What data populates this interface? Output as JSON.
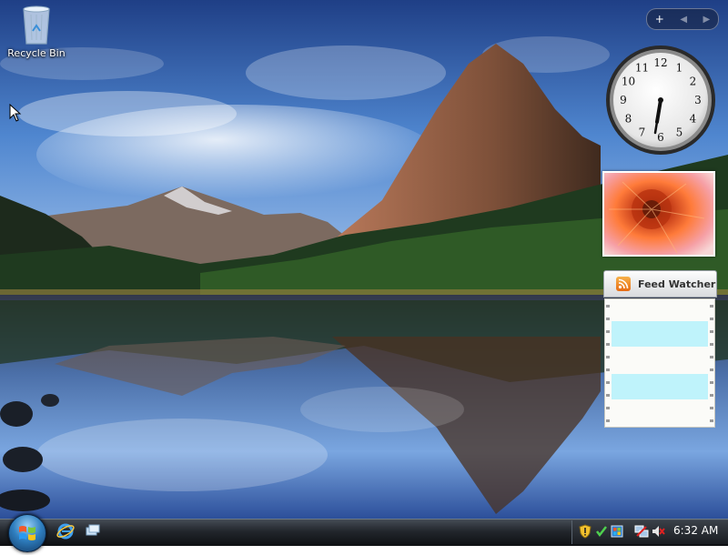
{
  "desktop": {
    "icons": [
      {
        "label": "Recycle Bin",
        "icon": "recycle-bin-icon"
      }
    ]
  },
  "sidebar": {
    "controls": {
      "add_symbol": "+",
      "prev_symbol": "◀",
      "next_symbol": "▶"
    },
    "clock": {
      "time_shown": "6:32",
      "numerals": [
        "12",
        "1",
        "2",
        "3",
        "4",
        "5",
        "6",
        "7",
        "8",
        "9",
        "10",
        "11"
      ]
    },
    "slideshow": {
      "image": "flower-photo"
    },
    "feed_watcher": {
      "title": "Feed Watcher",
      "icon": "rss-icon"
    }
  },
  "taskbar": {
    "start_button": "windows-logo-icon",
    "quick_launch": [
      "internet-explorer-icon",
      "show-desktop-icon"
    ],
    "tray_icons": [
      "security-shield-icon",
      "sync-center-icon",
      "windows-update-icon",
      "network-icon",
      "volume-muted-icon"
    ],
    "clock": "6:32 AM"
  },
  "colors": {
    "taskbar": "#1a1d22",
    "feed_item": "#bff3fb",
    "sky": "#2a5aa8"
  }
}
